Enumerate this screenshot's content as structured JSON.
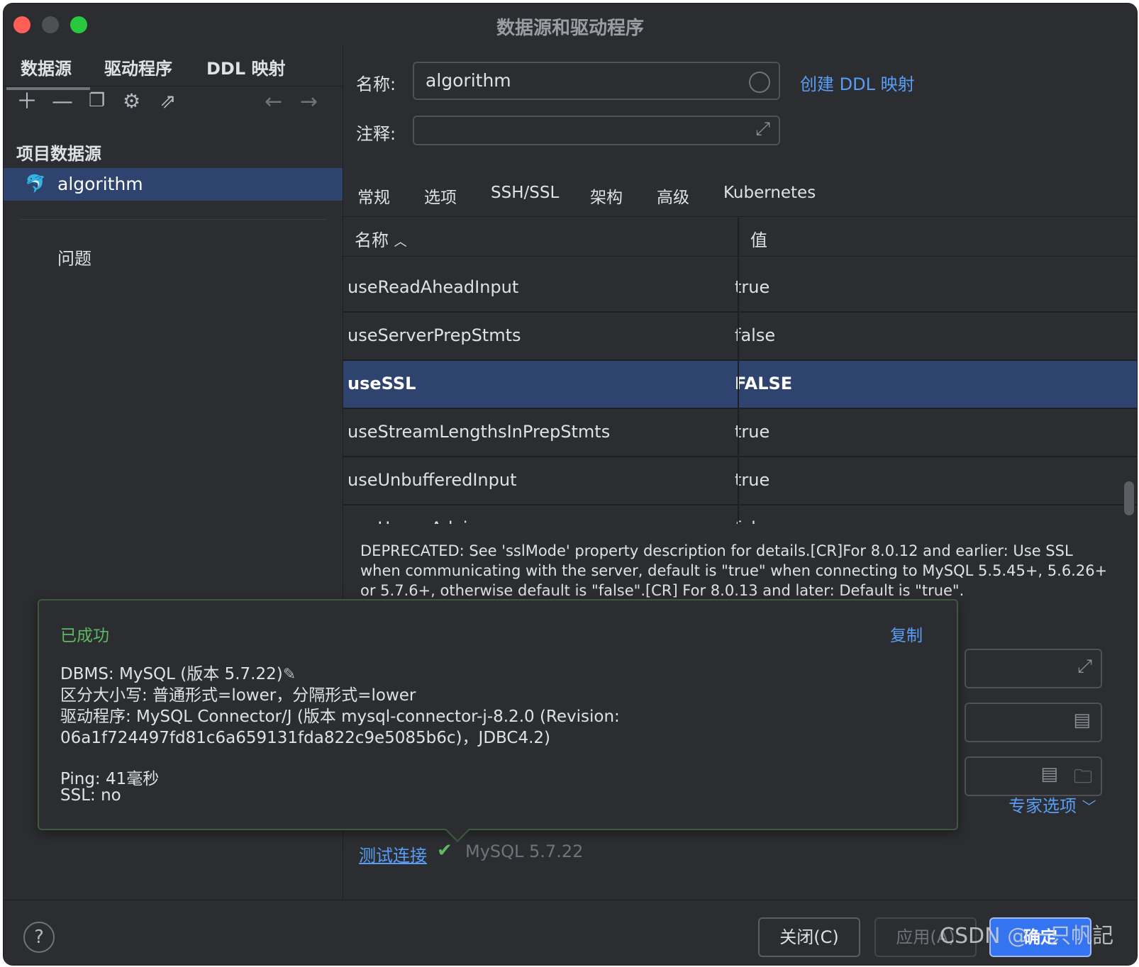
{
  "window": {
    "title": "数据源和驱动程序"
  },
  "left": {
    "tabs": [
      "数据源",
      "驱动程序",
      "DDL 映射"
    ],
    "section_title": "项目数据源",
    "datasource": "algorithm",
    "issues": "问题"
  },
  "form": {
    "name_label": "名称:",
    "name_value": "algorithm",
    "comment_label": "注释:",
    "create_ddl_link": "创建 DDL 映射"
  },
  "tabs": [
    "常规",
    "选项",
    "SSH/SSL",
    "架构",
    "高级",
    "Kubernetes"
  ],
  "active_tab": "高级",
  "table": {
    "col_name": "名称",
    "col_value": "值",
    "rows": [
      {
        "name": "useReadAheadInput",
        "value": "true"
      },
      {
        "name": "useServerPrepStmts",
        "value": "false"
      },
      {
        "name": "useSSL",
        "value": "FALSE",
        "selected": true
      },
      {
        "name": "useStreamLengthsInPrepStmts",
        "value": "true"
      },
      {
        "name": "useUnbufferedInput",
        "value": "true"
      },
      {
        "name": "useUsageAdvisor",
        "value": "false"
      }
    ]
  },
  "description": "DEPRECATED: See 'sslMode' property description for details.[CR]For 8.0.12 and earlier: Use SSL when communicating with the server, default is \"true\" when connecting to MySQL 5.5.45+, 5.6.26+ or 5.7.6+, otherwise default is \"false\".[CR] For 8.0.13 and later: Default is \"true\".",
  "popup": {
    "title": "已成功",
    "copy": "复制",
    "dbms": "DBMS: MySQL (版本 5.7.22)",
    "case": "区分大小写: 普通形式=lower，分隔形式=lower",
    "driver1": "驱动程序: MySQL Connector/J (版本 mysql-connector-j-8.2.0 (Revision:",
    "driver2": "06a1f724497fd81c6a659131fda822c9e5085b6c)，JDBC4.2)",
    "ping": "Ping: 41毫秒",
    "ssl": "SSL: no"
  },
  "expert_options": "专家选项",
  "test": {
    "link": "测试连接",
    "version": "MySQL 5.7.22"
  },
  "footer": {
    "close": "关闭(C)",
    "apply": "应用(A)",
    "ok": "确定",
    "help": "?"
  },
  "watermark": "CSDN @一只帆記",
  "colors": {
    "accent": "#3574f0",
    "selection": "#2e436e",
    "success": "#5fb865",
    "link": "#589df6",
    "background": "#2b2d30"
  },
  "icons": [
    "plus-icon",
    "minus-icon",
    "copy-icon",
    "gear-icon",
    "export-icon",
    "back-arrow-icon",
    "forward-arrow-icon",
    "mysql-dolphin-icon",
    "expand-icon",
    "sort-asc-icon",
    "document-icon",
    "folder-icon",
    "chevron-down-icon",
    "check-icon",
    "pencil-icon",
    "help-icon"
  ]
}
